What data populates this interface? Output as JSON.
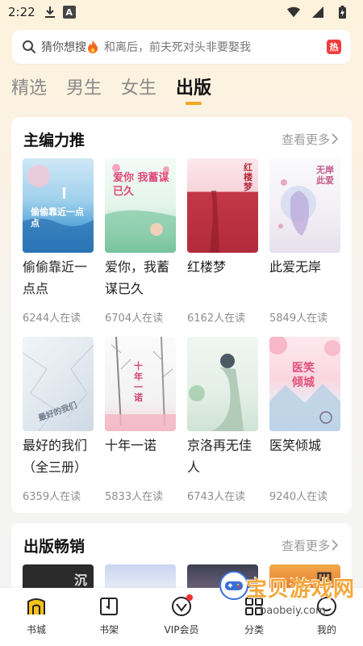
{
  "status_bar": {
    "time": "2:22",
    "a_badge": "A"
  },
  "search": {
    "hint_primary": "猜你想搜",
    "hint_secondary": "和离后，前夫死对头非要娶我",
    "hot_label": "热"
  },
  "tabs": [
    {
      "label": "精选",
      "active": false
    },
    {
      "label": "男生",
      "active": false
    },
    {
      "label": "女生",
      "active": false
    },
    {
      "label": "出版",
      "active": true
    }
  ],
  "section_recommend": {
    "title": "主编力推",
    "more": "查看更多",
    "books": [
      {
        "title": "偷偷靠近一点点",
        "readers": "6244人在读",
        "cover_text": "偷偷靠近一点点"
      },
      {
        "title": "爱你，我蓄谋已久",
        "readers": "6704人在读",
        "cover_text": "爱你 我蓄谋已久"
      },
      {
        "title": "红楼梦",
        "readers": "6162人在读",
        "cover_text": "红楼梦"
      },
      {
        "title": "此爱无岸",
        "readers": "5849人在读",
        "cover_text": "无岸此爱"
      },
      {
        "title": "最好的我们（全三册）",
        "readers": "6359人在读",
        "cover_text": "最好的我们"
      },
      {
        "title": "十年一诺",
        "readers": "5833人在读",
        "cover_text": "十年一诺"
      },
      {
        "title": "京洛再无佳人",
        "readers": "6743人在读",
        "cover_text": ""
      },
      {
        "title": "医笑倾城",
        "readers": "9240人在读",
        "cover_text": "医笑倾城"
      }
    ]
  },
  "section_bestseller": {
    "title": "出版畅销",
    "more": "查看更多",
    "cover_texts": [
      "沉",
      "四"
    ]
  },
  "bottom_nav": [
    {
      "label": "书城",
      "icon": "bookstore-icon",
      "active": true
    },
    {
      "label": "书架",
      "icon": "bookshelf-icon",
      "active": false
    },
    {
      "label": "VIP会员",
      "icon": "vip-icon",
      "active": false
    },
    {
      "label": "分类",
      "icon": "category-icon",
      "active": false
    },
    {
      "label": "我的",
      "icon": "profile-icon",
      "active": false
    }
  ],
  "watermark": {
    "text": "宝贝游戏网",
    "url": "baobeiy.com"
  },
  "colors": {
    "accent": "#f5a623",
    "hot": "#ef3b3b",
    "nav_active": "#f7c21a"
  }
}
